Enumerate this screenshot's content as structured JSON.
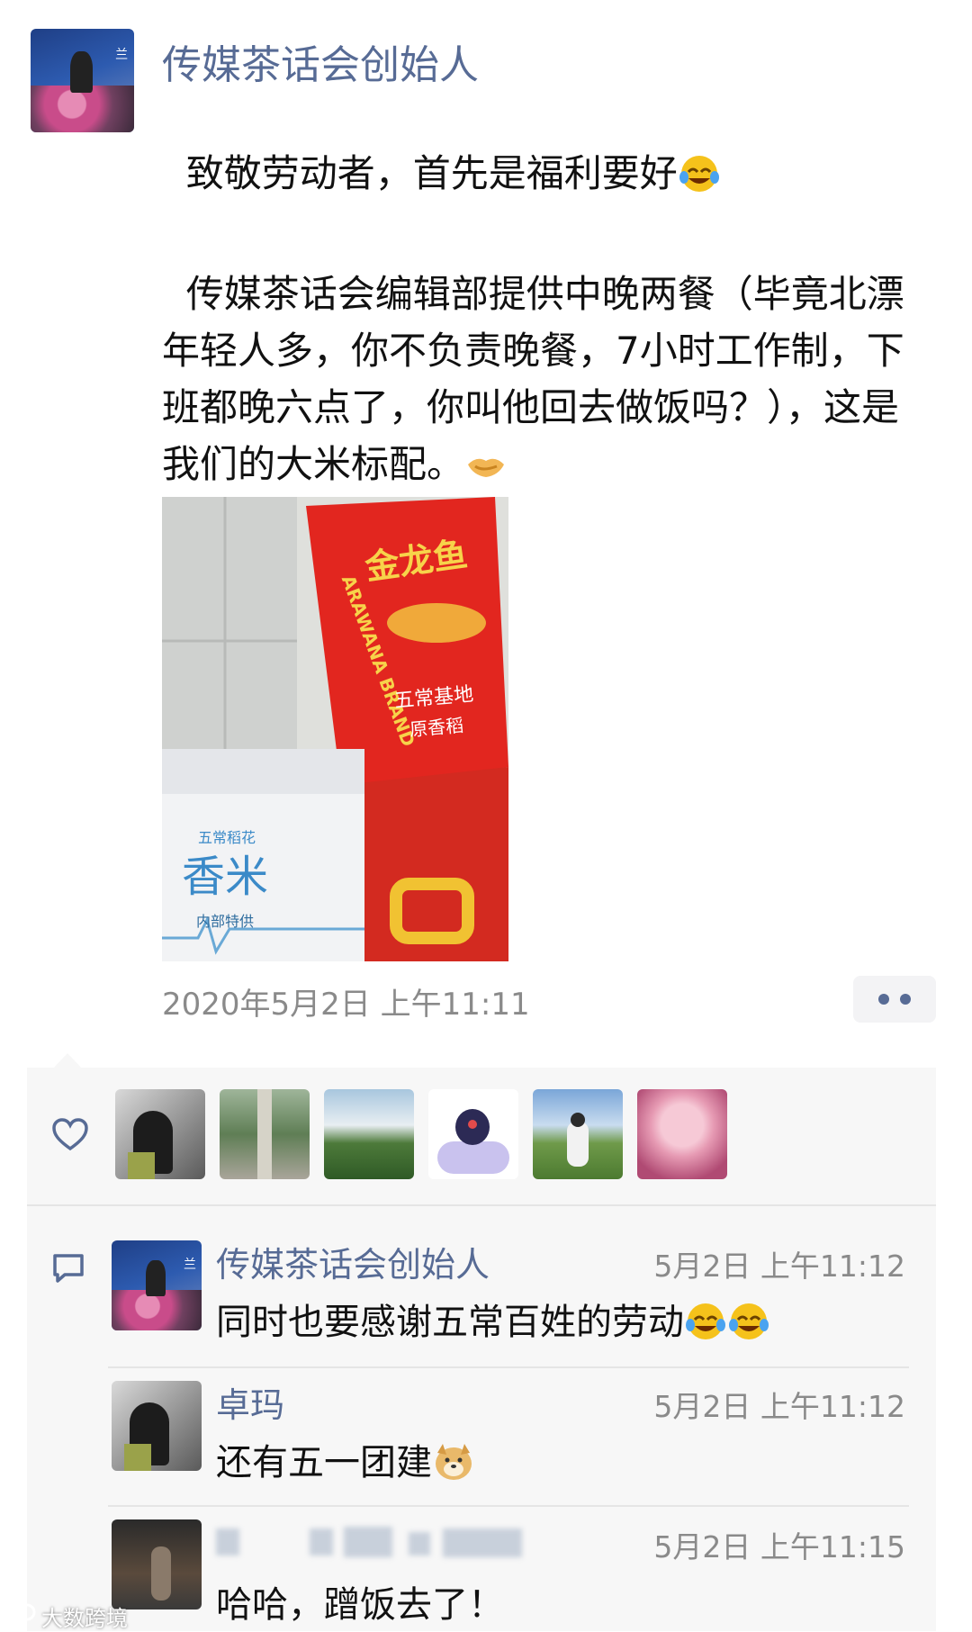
{
  "post": {
    "author": "传媒茶话会创始人",
    "text_line1": "致敬劳动者，首先是福利要好",
    "text_body": "传媒茶话会编辑部提供中晚两餐（毕竟北漂年轻人多，你不负责晚餐，7小时工作制，下班都晚六点了，你叫他回去做饭吗？），这是我们的大米标配。",
    "timestamp": "2020年5月2日 上午11:11",
    "photo": {
      "bag_brand": "金龙鱼",
      "bag_brand_en": "ARAWANA BRAND",
      "bag_line1": "五常基地",
      "bag_line2": "原香稻",
      "box_small": "五常稻花",
      "box_big": "香米",
      "box_sub": "内部特供"
    }
  },
  "icons": {
    "like": "heart-outline-icon",
    "comment": "comment-bubble-icon",
    "more": "more-dots-icon",
    "laugh_emoji": "tears-of-joy-emoji",
    "handshake_emoji": "handshake-emoji",
    "dog_emoji": "doge-emoji"
  },
  "comments": [
    {
      "name": "传媒茶话会创始人",
      "time": "5月2日 上午11:12",
      "text": "同时也要感谢五常百姓的劳动"
    },
    {
      "name": "卓玛",
      "time": "5月2日 上午11:12",
      "text": "还有五一团建"
    },
    {
      "name": "",
      "time": "5月2日 上午11:15",
      "text": "哈哈，蹭饭去了！"
    }
  ],
  "watermark": "大数跨境",
  "colors": {
    "link": "#576b95",
    "panel_bg": "#f7f7f7",
    "time_gray": "#8a8a8a"
  }
}
